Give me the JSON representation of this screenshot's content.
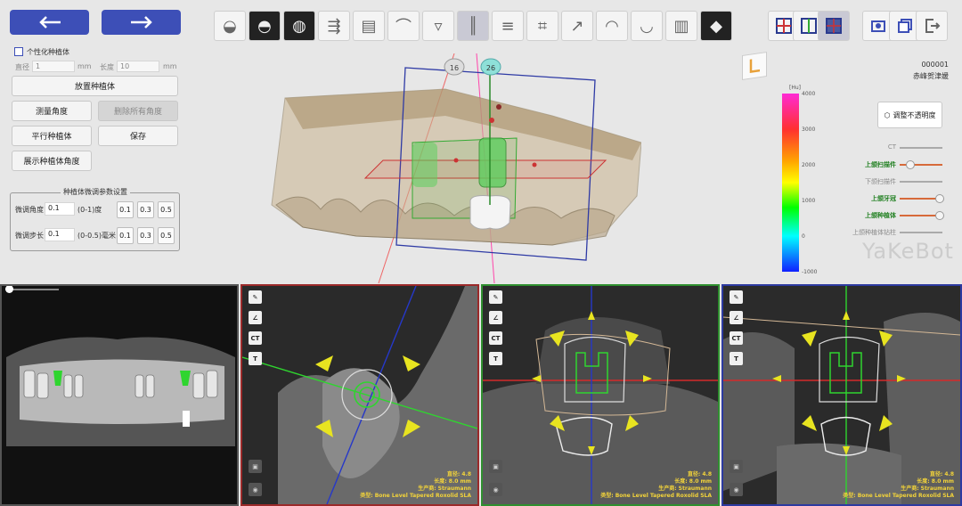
{
  "nav": {
    "back_icon": "arrow-left-icon",
    "forward_icon": "arrow-right-icon"
  },
  "toolbar": {
    "tools": [
      "tooth-icon",
      "ct-tooth-icon",
      "tooth-section-icon",
      "scan-align-icon",
      "scanner-icon",
      "nerve-icon",
      "implant-icon",
      "implant-axis-icon",
      "report-icon",
      "crop-icon",
      "drill-icon",
      "crown-icon",
      "tooth-edit-icon",
      "guide-icon",
      "export-icon"
    ],
    "right_a": [
      "grid-red-icon",
      "grid-green-icon",
      "grid-blue-icon"
    ],
    "right_b": [
      "screenshot-icon",
      "copy-icon",
      "exit-icon"
    ]
  },
  "left_panel": {
    "personalize_label": "个性化种植体",
    "diameter_label": "直径",
    "diameter_value": "1",
    "diameter_unit": "mm",
    "length_label": "长度",
    "length_value": "10",
    "length_unit": "mm",
    "place_btn": "放置种植体",
    "measure_btn": "测量角度",
    "delete_angles_btn": "删除所有角度",
    "parallel_btn": "平行种植体",
    "save_btn": "保存",
    "show_angle_btn": "展示种植体角度",
    "fine_group_title": "种植体微调参数设置",
    "fine_angle_label": "微调角度",
    "fine_angle_value": "0.1",
    "fine_angle_range": "(0-1)度",
    "fine_step_label": "微调步长",
    "fine_step_value": "0.1",
    "fine_step_range": "(0-0.5)毫米",
    "presets": [
      "0.1",
      "0.3",
      "0.5"
    ]
  },
  "viewer3d": {
    "tooth_a": "16",
    "tooth_b": "26"
  },
  "patient": {
    "id": "000001",
    "name": "赤峰贺津媛"
  },
  "orientation_icon": "axis-cube-icon",
  "colorbar": {
    "unit": "[Hu]",
    "ticks": [
      "4000",
      "3000",
      "2000",
      "1000",
      "0",
      "-1000"
    ]
  },
  "opacity_btn": "调整不透明度",
  "opacity_icon": "cube-icon",
  "layers": [
    {
      "label": "CT",
      "color": "#8a8a8a",
      "value": null
    },
    {
      "label": "上颌扫描件",
      "color": "#1f7f1f",
      "value": 0.25
    },
    {
      "label": "下颌扫描件",
      "color": "#8a8a8a",
      "value": null
    },
    {
      "label": "上颌牙冠",
      "color": "#1f7f1f",
      "value": 1.0
    },
    {
      "label": "上颌种植体",
      "color": "#1f7f1f",
      "value": 1.0
    },
    {
      "label": "上颌种植体钻柱",
      "color": "#8a8a8a",
      "value": null
    }
  ],
  "brand": "YaKeBot",
  "panels": {
    "tool_icons": [
      "pencil-icon",
      "angle-icon",
      "ct-icon",
      "text-icon"
    ],
    "bottom_icons": [
      "layer-icon",
      "eye-icon"
    ],
    "tool_ct": "CT",
    "tool_t": "T",
    "info": [
      "直径: 4.8",
      "长度: 8.0 mm",
      "生产商: Straumann",
      "类型: Bone Level Tapered Roxolid SLA"
    ]
  },
  "colors": {
    "nav": "#3d4fb7",
    "axial_border": "#9b2a2a",
    "coronal_border": "#2f8f2f",
    "sagittal_border": "#2d3aa0",
    "info_text": "#f2d33a"
  }
}
